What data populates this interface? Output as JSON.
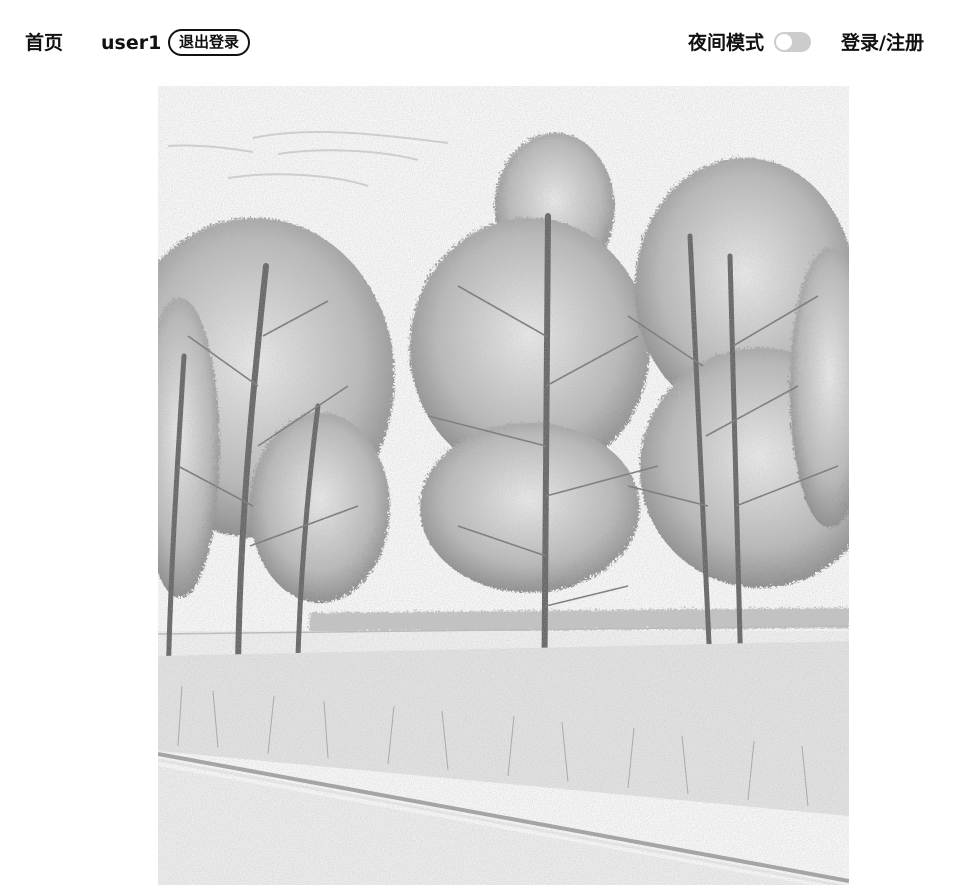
{
  "nav": {
    "home_label": "首页",
    "username": "user1",
    "logout_label": "退出登录",
    "night_mode_label": "夜间模式",
    "night_mode_on": false,
    "login_label": "登录/注册"
  },
  "image": {
    "alt": "pencil sketch of pine trees"
  },
  "colors": {
    "text": "#111111",
    "toggle_off": "#cccccc",
    "background": "#ffffff"
  }
}
